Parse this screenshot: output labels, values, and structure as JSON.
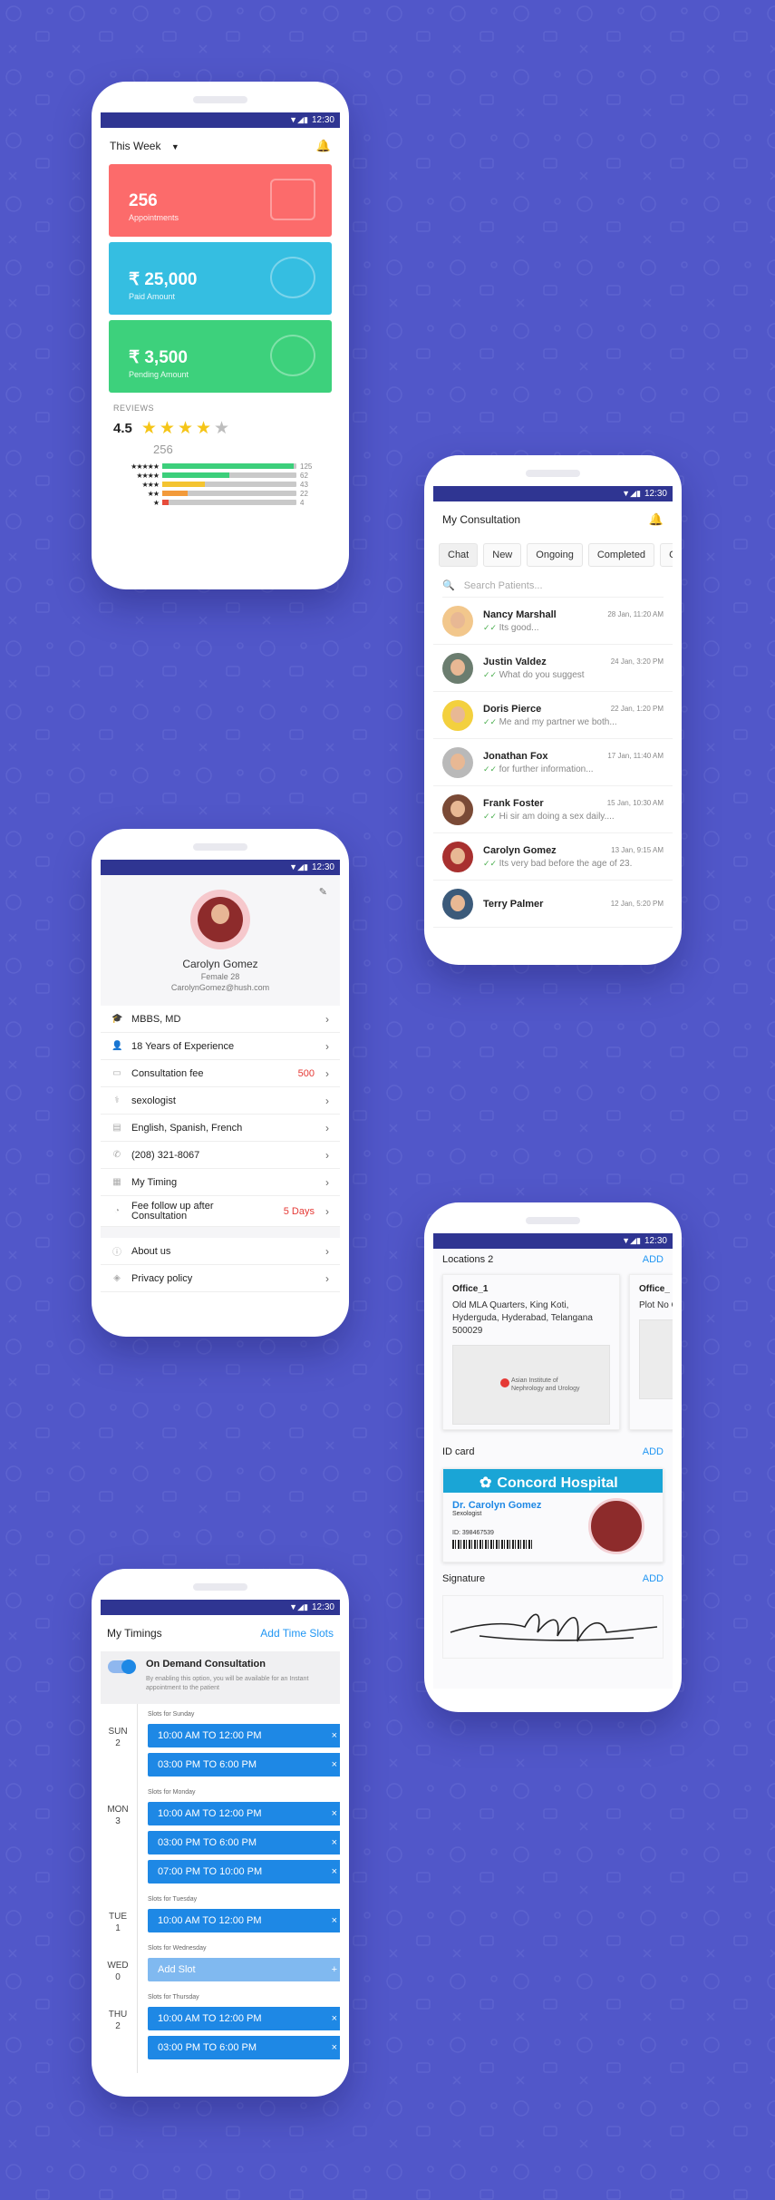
{
  "status_time": "12:30",
  "dashboard": {
    "period": "This Week",
    "cards": [
      {
        "value": "256",
        "label": "Appointments",
        "color": "#fc6b6b"
      },
      {
        "value": "₹ 25,000",
        "label": "Paid Amount",
        "color": "#35bee1"
      },
      {
        "value": "₹ 3,500",
        "label": "Pending Amount",
        "color": "#3dd17c"
      }
    ],
    "reviews_title": "REVIEWS",
    "rating": "4.5",
    "rating_stars": 4,
    "review_count": "256",
    "breakdown": [
      {
        "stars": "★★★★★",
        "count": "125",
        "fraction": 0.98,
        "color": "#3ccf7b"
      },
      {
        "stars": "★★★★",
        "count": "62",
        "fraction": 0.5,
        "color": "#3ccf7b"
      },
      {
        "stars": "★★★",
        "count": "43",
        "fraction": 0.32,
        "color": "#f4c430"
      },
      {
        "stars": "★★",
        "count": "22",
        "fraction": 0.19,
        "color": "#f29a3a"
      },
      {
        "stars": "★",
        "count": "4",
        "fraction": 0.05,
        "color": "#e74c3c"
      }
    ]
  },
  "consultation": {
    "title": "My Consultation",
    "tabs": [
      "Chat",
      "New",
      "Ongoing",
      "Completed",
      "C"
    ],
    "search_placeholder": "Search Patients...",
    "chats": [
      {
        "name": "Nancy Marshall",
        "date": "28 Jan, 11:20 AM",
        "msg": "Its good...",
        "avatar_color": "#f2c78c"
      },
      {
        "name": "Justin Valdez",
        "date": "24 Jan, 3:20 PM",
        "msg": "What do you suggest",
        "avatar_color": "#6b7d6f"
      },
      {
        "name": "Doris Pierce",
        "date": "22 Jan, 1:20 PM",
        "msg": "Me and my partner we both...",
        "avatar_color": "#f3d03e"
      },
      {
        "name": "Jonathan Fox",
        "date": "17 Jan, 11:40 AM",
        "msg": "for further information...",
        "avatar_color": "#b9b9b9"
      },
      {
        "name": "Frank Foster",
        "date": "15 Jan, 10:30 AM",
        "msg": "Hi sir am doing a sex daily....",
        "avatar_color": "#7a4a36"
      },
      {
        "name": "Carolyn Gomez",
        "date": "13 Jan, 9:15 AM",
        "msg": "Its very bad before the age of 23.",
        "avatar_color": "#a8302f"
      },
      {
        "name": "Terry Palmer",
        "date": "12 Jan, 5:20 PM",
        "msg": "",
        "avatar_color": "#3b5a7a"
      }
    ]
  },
  "profile": {
    "name": "Carolyn Gomez",
    "sub": "Female 28",
    "email": "CarolynGomez@hush.com",
    "rows": [
      {
        "icon": "degree-icon",
        "glyph": "🎓",
        "label": "MBBS, MD",
        "value": ""
      },
      {
        "icon": "person-icon",
        "glyph": "👤",
        "label": "18 Years of Experience",
        "value": ""
      },
      {
        "icon": "money-icon",
        "glyph": "▭",
        "label": "Consultation fee",
        "value": "500"
      },
      {
        "icon": "specialty-icon",
        "glyph": "⚕",
        "label": "sexologist",
        "value": ""
      },
      {
        "icon": "language-icon",
        "glyph": "▤",
        "label": "English, Spanish, French",
        "value": ""
      },
      {
        "icon": "phone-icon",
        "glyph": "✆",
        "label": "(208) 321-8067",
        "value": ""
      },
      {
        "icon": "calendar-icon",
        "glyph": "▦",
        "label": "My Timing",
        "value": ""
      },
      {
        "icon": "followup-icon",
        "glyph": "◔",
        "label": "Fee follow up after Consultation",
        "value": "5 Days"
      }
    ],
    "extra_rows": [
      {
        "icon": "info-icon",
        "glyph": "ⓘ",
        "label": "About us"
      },
      {
        "icon": "shield-icon",
        "glyph": "◈",
        "label": "Privacy policy"
      }
    ]
  },
  "locations": {
    "title": "Locations 2",
    "add": "ADD",
    "offices": [
      {
        "name": "Office_1",
        "address": "Old MLA Quarters, King Koti, Hyderguda, Hyderabad, Telangana 500029",
        "map_label": "Asian Institute of Nephrology and Urology"
      },
      {
        "name": "Office_",
        "address": "Plot No Old MLA King K",
        "map_label": ""
      }
    ],
    "id_title": "ID card",
    "id_add": "ADD",
    "hospital": "Concord Hospital",
    "id_name": "Dr. Carolyn Gomez",
    "id_role": "Sexologist",
    "id_number": "ID: 398467539",
    "signature_title": "Signature",
    "signature_add": "ADD"
  },
  "timings": {
    "title": "My Timings",
    "add": "Add Time Slots",
    "on_demand_title": "On Demand Consultation",
    "on_demand_desc": "By enabling this option, you will be available for an Instant appointment to the patient",
    "days": [
      {
        "day": "SUN",
        "num": "2",
        "header": "Slots for Sunday",
        "slots": [
          "10:00 AM TO 12:00 PM",
          "03:00 PM TO 6:00 PM"
        ]
      },
      {
        "day": "MON",
        "num": "3",
        "header": "Slots for Monday",
        "slots": [
          "10:00 AM TO 12:00 PM",
          "03:00 PM TO 6:00 PM",
          "07:00 PM TO 10:00 PM"
        ]
      },
      {
        "day": "TUE",
        "num": "1",
        "header": "Slots for Tuesday",
        "slots": [
          "10:00 AM TO 12:00 PM"
        ]
      },
      {
        "day": "WED",
        "num": "0",
        "header": "Slots for Wednesday",
        "slots": [],
        "add_slot": "Add Slot"
      },
      {
        "day": "THU",
        "num": "2",
        "header": "Slots for Thursday",
        "slots": [
          "10:00 AM TO 12:00 PM",
          "03:00 PM TO 6:00 PM"
        ]
      }
    ]
  }
}
